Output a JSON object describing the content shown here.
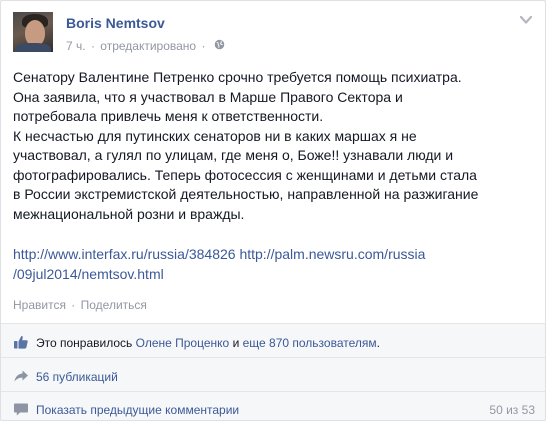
{
  "post": {
    "author": "Boris Nemtsov",
    "time": "7 ч.",
    "separator": "·",
    "edited": "отредактировано",
    "separator2": "·",
    "privacy_icon": "globe-icon",
    "options_icon": "chevron-down-icon",
    "text_lines": [
      "Сенатору Валентине Петренко срочно требуется помощь психиатра.",
      "Она заявила, что я участвовал в Марше Правого Сектора и",
      "потребовала привлечь меня к ответственности.",
      "К несчастью для путинских сенаторов ни в каких маршах я не",
      "участвовал, а гулял по улицам, где меня о, Боже!! узнавали люди и",
      "фотографировались. Теперь фотосессия с женщинами и детьми стала",
      "в России экстремистской деятельностью, направленной на разжигание",
      "межнациональной розни и вражды."
    ],
    "link1": "http://www.interfax.ru/russia/384826",
    "link2_part1": "http://palm.newsru.com/russia",
    "link2_part2": "/09jul2014/nemtsov.html"
  },
  "actions": {
    "like": "Нравится",
    "dot": "·",
    "share": "Поделиться"
  },
  "ufi": {
    "likes_prefix": "Это понравилось",
    "likes_name": "Олене Проценко",
    "likes_and": "и",
    "likes_others": "еще 870 пользователям",
    "likes_suffix": ".",
    "like_icon": "thumbs-up-icon",
    "shares": "56 публикаций",
    "share_icon": "share-arrow-icon",
    "comments_label": "Показать предыдущие комментарии",
    "comments_icon": "comment-icon",
    "comments_count": "50 из 53"
  },
  "colors": {
    "link": "#3b5998",
    "muted": "#9197a3",
    "ufi_bg": "#f6f7f8"
  }
}
